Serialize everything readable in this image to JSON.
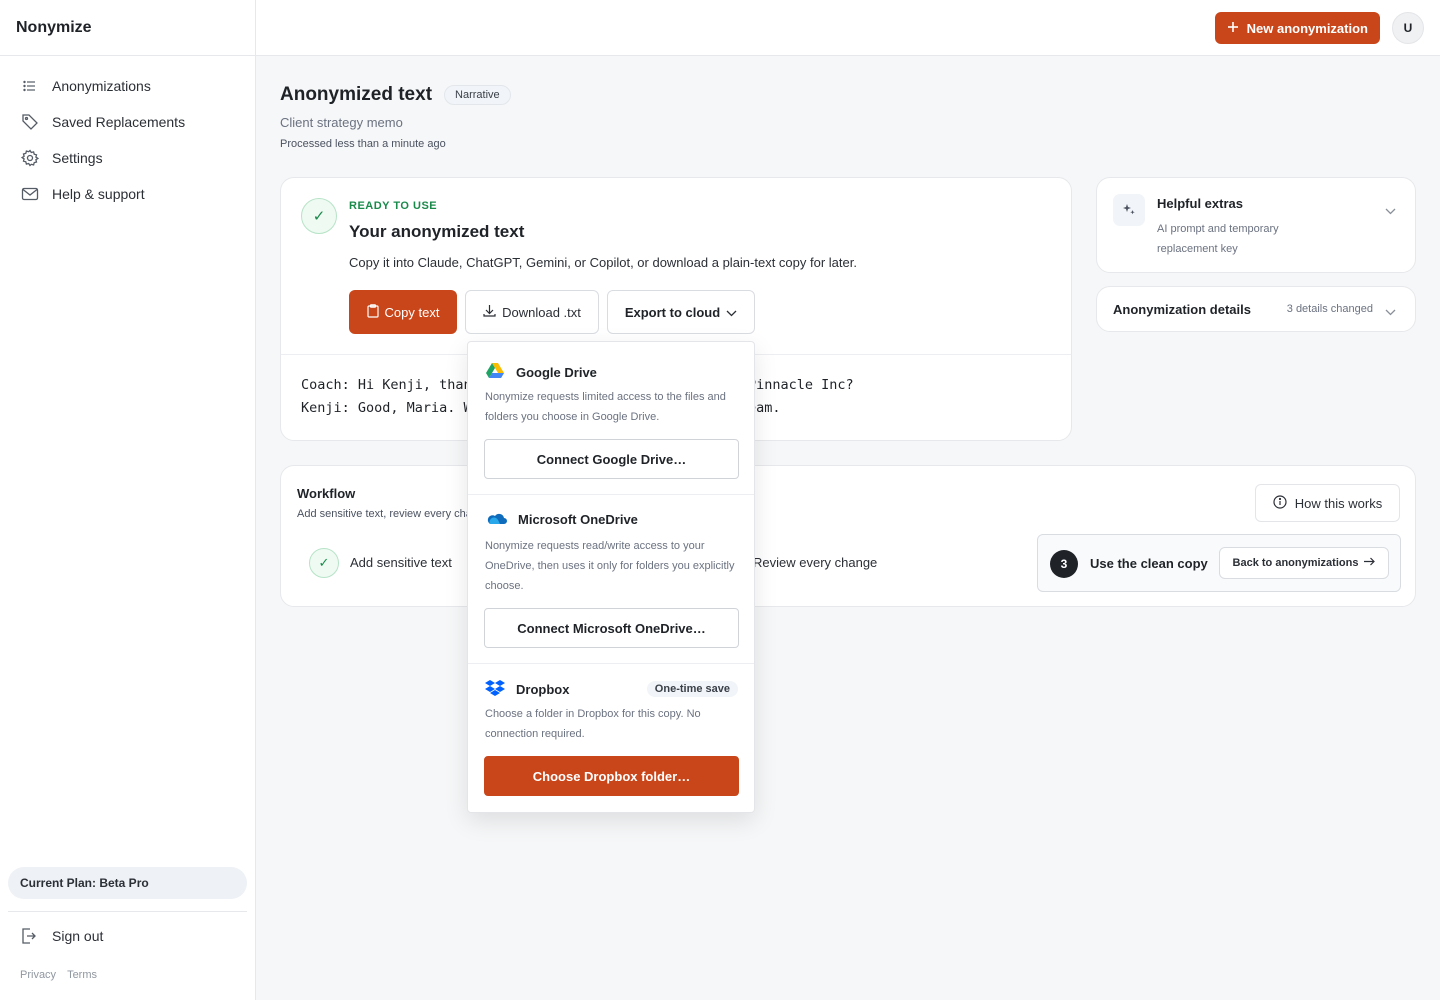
{
  "app": {
    "name": "Nonymize"
  },
  "sidebar": {
    "items": [
      {
        "label": "Anonymizations",
        "icon": "list-icon"
      },
      {
        "label": "Saved Replacements",
        "icon": "tag-icon"
      },
      {
        "label": "Settings",
        "icon": "gear-icon"
      },
      {
        "label": "Help & support",
        "icon": "mail-icon"
      }
    ],
    "plan": "Current Plan: Beta Pro",
    "sign_out": "Sign out",
    "privacy": "Privacy",
    "terms": "Terms"
  },
  "topbar": {
    "new_button": "New anonymization",
    "avatar": "U"
  },
  "page": {
    "title": "Anonymized text",
    "badge": "Narrative",
    "subtitle": "Client strategy memo",
    "processed": "Processed less than a minute ago"
  },
  "ready": {
    "label": "READY TO USE",
    "title": "Your anonymized text",
    "description": "Copy it into Claude, ChatGPT, Gemini, or Copilot, or download a plain-text copy for later.",
    "copy_button": "Copy text",
    "download_button": "Download .txt",
    "export_button": "Export to cloud",
    "text_lines": [
      "Coach: Hi Kenji, thanks for joining. How are things at Pinnacle Inc?",
      "Kenji: Good, Maria. We are working with the marketing team."
    ]
  },
  "extras": {
    "title": "Helpful extras",
    "description": "AI prompt and temporary replacement key"
  },
  "details": {
    "title": "Anonymization details",
    "meta": "3 details changed"
  },
  "workflow": {
    "title": "Workflow",
    "description": "Add sensitive text, review every change, then use the clean copy.",
    "step1": "Add sensitive text",
    "step2": "Review every change",
    "step3_number": "3",
    "step3": "Use the clean copy",
    "how_button": "How this works",
    "back_button": "Back to anonymizations"
  },
  "export_menu": {
    "providers": [
      {
        "name": "Google Drive",
        "description": "Nonymize requests limited access to the files and folders you choose in Google Drive.",
        "button": "Connect Google Drive…"
      },
      {
        "name": "Microsoft OneDrive",
        "description": "Nonymize requests read/write access to your OneDrive, then uses it only for folders you explicitly choose.",
        "button": "Connect Microsoft OneDrive…"
      },
      {
        "name": "Dropbox",
        "badge": "One-time save",
        "description": "Choose a folder in Dropbox for this copy. No connection required.",
        "button": "Choose Dropbox folder…"
      }
    ]
  },
  "colors": {
    "accent": "#c9461a",
    "success": "#1a8a4b"
  }
}
